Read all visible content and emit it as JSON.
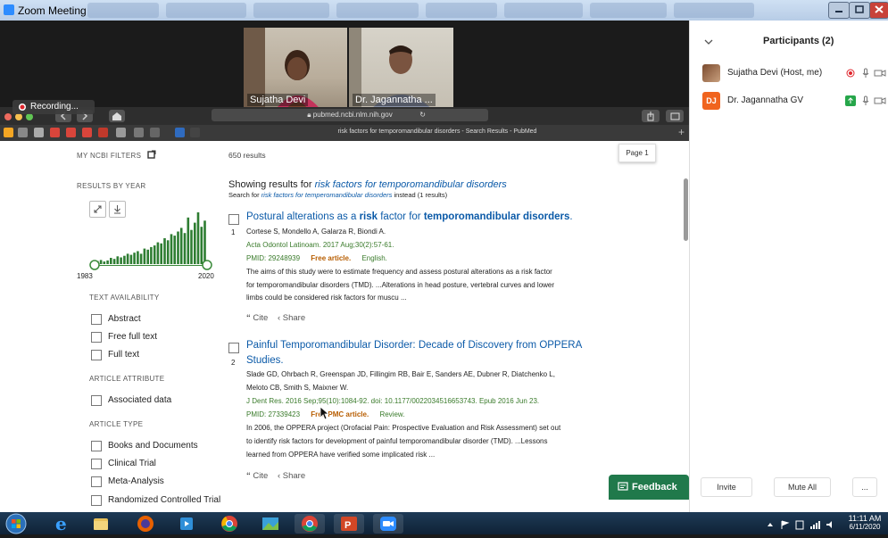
{
  "window": {
    "title": "Zoom Meeting"
  },
  "video": {
    "tiles": [
      {
        "name": "Sujatha Devi"
      },
      {
        "name": "Dr. Jagannatha ..."
      }
    ],
    "recording_label": "Recording..."
  },
  "browser": {
    "url": "pubmed.ncbi.nlm.nih.gov",
    "tab_title": "risk factors for temporomandibular disorders - Search Results - PubMed",
    "page_indicator": "Page 1"
  },
  "sidebar": {
    "my_filters": "MY NCBI FILTERS",
    "results_by_year": "RESULTS BY YEAR",
    "year_start": "1983",
    "year_end": "2020",
    "text_availability": "TEXT AVAILABILITY",
    "availability_items": [
      "Abstract",
      "Free full text",
      "Full text"
    ],
    "article_attribute": "ARTICLE ATTRIBUTE",
    "attribute_items": [
      "Associated data"
    ],
    "article_type": "ARTICLE TYPE",
    "type_items": [
      "Books and Documents",
      "Clinical Trial",
      "Meta-Analysis",
      "Randomized Controlled Trial"
    ],
    "histogram": [
      0.06,
      0.08,
      0.05,
      0.07,
      0.12,
      0.1,
      0.15,
      0.13,
      0.16,
      0.2,
      0.18,
      0.22,
      0.25,
      0.2,
      0.3,
      0.28,
      0.33,
      0.36,
      0.42,
      0.4,
      0.5,
      0.46,
      0.58,
      0.55,
      0.63,
      0.7,
      0.6,
      0.9,
      0.66,
      0.8,
      1.0,
      0.72,
      0.84
    ]
  },
  "results": {
    "count": "650 results",
    "showing_prefix": "Showing results for ",
    "showing_query": "risk factors for temporomandibular disorders",
    "search_for_prefix": "Search for ",
    "search_for_query": "risk factors for temperomandibular disorders",
    "search_for_suffix": " instead (1 results)",
    "items": [
      {
        "num": "1",
        "title_parts": [
          "Postural alterations as a ",
          "risk",
          " factor for ",
          "temporomandibular disorders",
          "."
        ],
        "authors": "Cortese S, Mondello A, Galarza R, Biondi A.",
        "journal": "Acta Odontol Latinoam. 2017 Aug;30(2):57-61.",
        "pmid": "PMID: 29248939",
        "free": "Free article.",
        "extra": "English.",
        "snippet_1": "The aims of this study were to estimate frequency and assess postural alterations as a risk factor",
        "snippet_2": "for temporomandibular disorders (TMD). ...Alterations in head posture, vertebral curves and lower",
        "snippet_3": "limbs could be considered risk factors for muscu ...",
        "cite": "Cite",
        "share": "Share"
      },
      {
        "num": "2",
        "title_line1": "Painful Temporomandibular Disorder: Decade of Discovery from OPPERA",
        "title_line2": "Studies.",
        "authors_1": "Slade GD, Ohrbach R, Greenspan JD, Fillingim RB, Bair E, Sanders AE, Dubner R, Diatchenko L,",
        "authors_2": "Meloto CB, Smith S, Maixner W.",
        "journal": "J Dent Res. 2016 Sep;95(10):1084-92. doi: 10.1177/0022034516653743. Epub 2016 Jun 23.",
        "pmid": "PMID: 27339423",
        "free": "Free PMC article.",
        "extra": "Review.",
        "snippet_1": "In 2006, the OPPERA project (Orofacial Pain: Prospective Evaluation and Risk Assessment) set out",
        "snippet_2": "to identify risk factors for development of painful temporomandibular disorder (TMD). ...Lessons",
        "snippet_3": "learned from OPPERA have verified some implicated risk ...",
        "cite": "Cite",
        "share": "Share"
      }
    ],
    "feedback": "Feedback"
  },
  "participants": {
    "header": "Participants (2)",
    "list": [
      {
        "initials": "",
        "name": "Sujatha Devi (Host, me)"
      },
      {
        "initials": "DJ",
        "name": "Dr. Jagannatha GV"
      }
    ],
    "invite": "Invite",
    "mute_all": "Mute All",
    "more": "..."
  },
  "taskbar": {
    "time": "11:11 AM",
    "date": "6/11/2020"
  }
}
